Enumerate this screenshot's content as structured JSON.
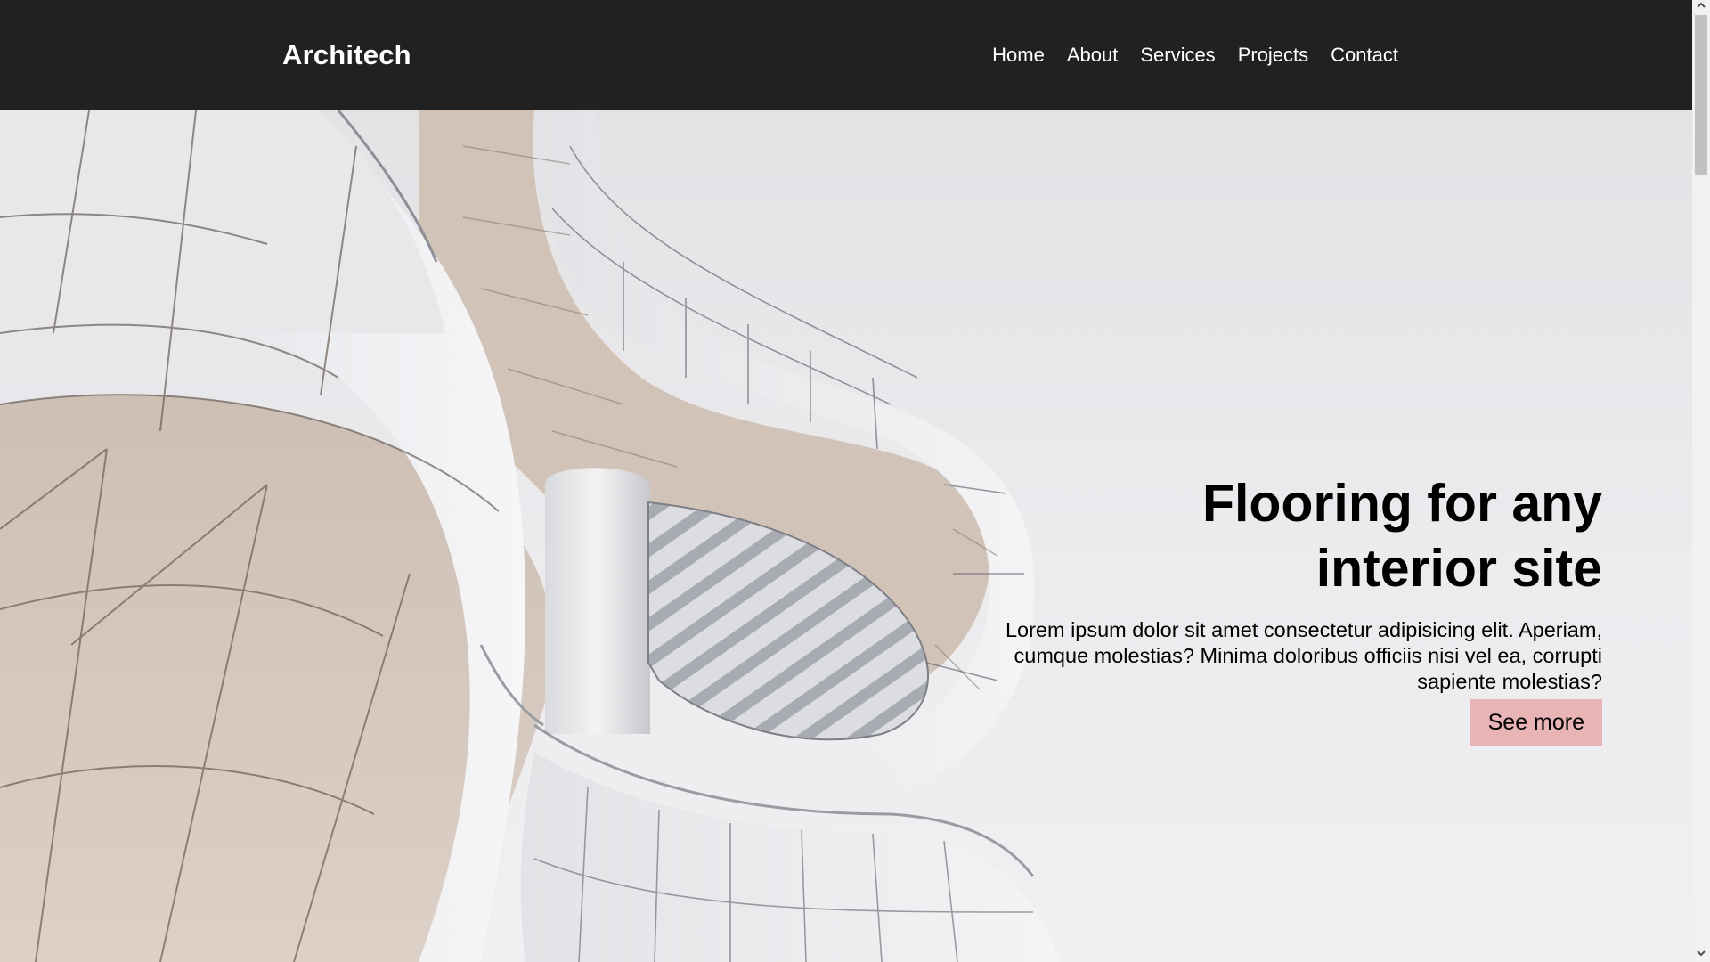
{
  "header": {
    "brand": "Architech",
    "nav": [
      "Home",
      "About",
      "Services",
      "Projects",
      "Contact"
    ]
  },
  "hero": {
    "title_line1": "Flooring for any",
    "title_line2": "interior site",
    "text": "Lorem ipsum dolor sit amet consectetur adipisicing elit. Aperiam, cumque molestias? Minima doloribus officiis nisi vel ea, corrupti sapiente molestias?",
    "button_label": "See more"
  },
  "colors": {
    "navbar_bg": "#212121",
    "button_bg": "#e8b4b6",
    "hero_bg": "#e9e9eb"
  },
  "icons": {
    "scroll_up": "chevron-up-icon",
    "scroll_down": "chevron-down-icon"
  }
}
